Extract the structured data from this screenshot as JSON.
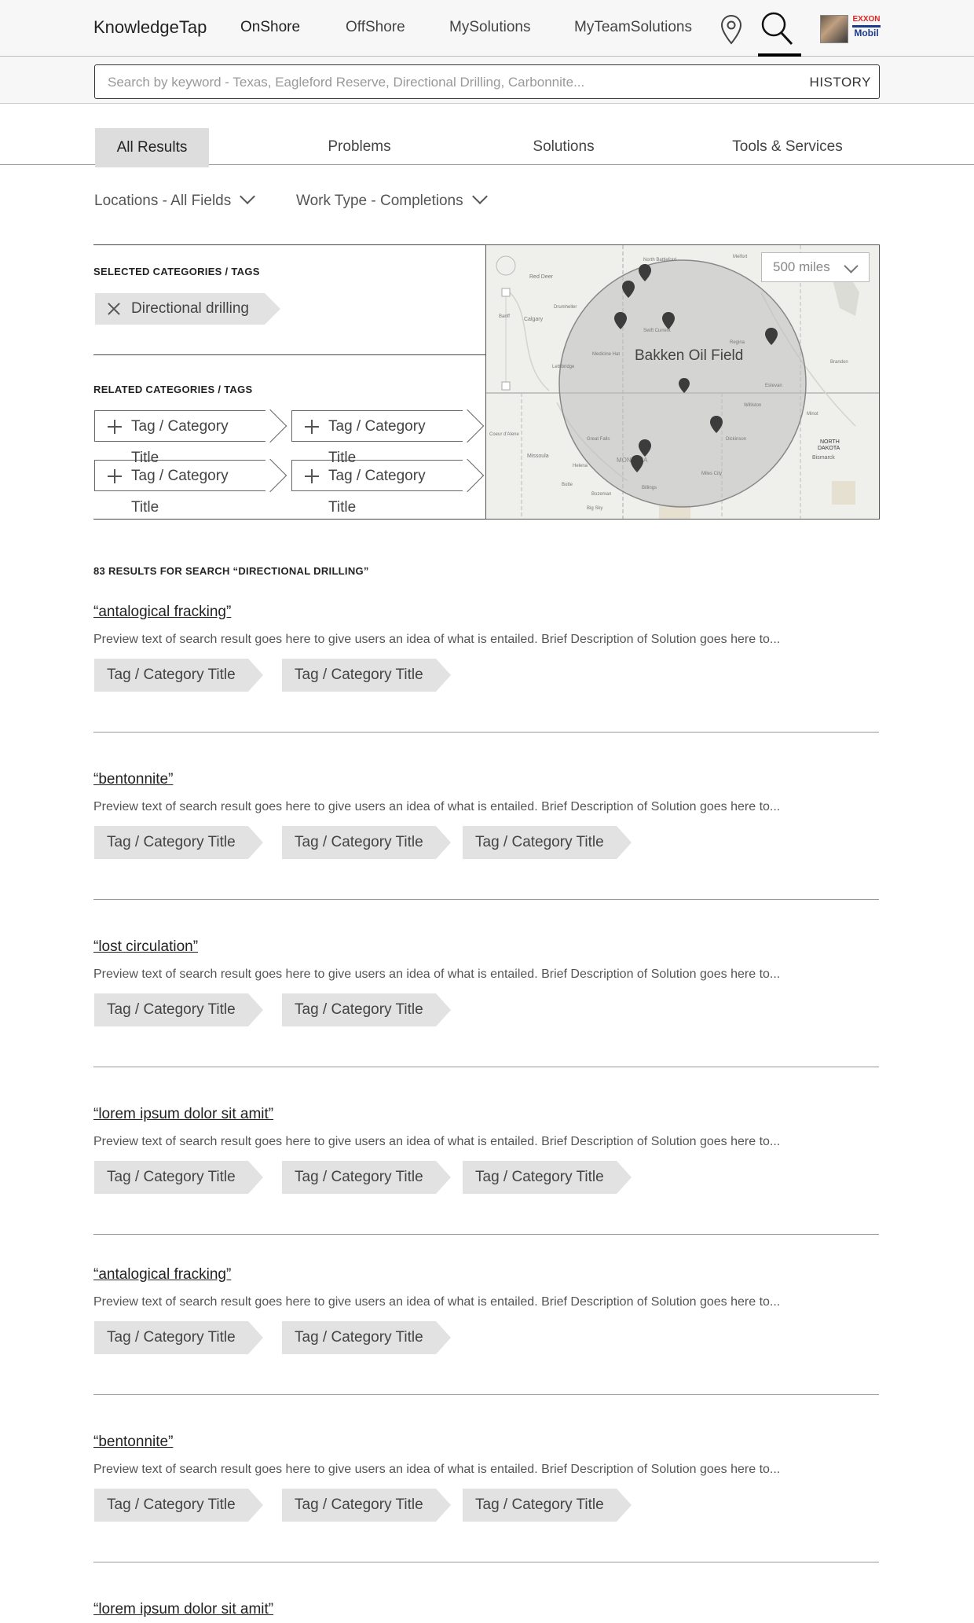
{
  "header": {
    "brand": "KnowledgeTap",
    "nav": [
      "OnShore",
      "OffShore",
      "MySolutions",
      "MyTeamSolutions"
    ],
    "logo_top": "EXXON",
    "logo_bottom": "Mobil"
  },
  "search": {
    "placeholder": "Search by keyword - Texas, Eagleford Reserve, Directional Drilling, Carbonnite...",
    "history_label": "HISTORY"
  },
  "tabs": [
    "All Results",
    "Problems",
    "Solutions",
    "Tools & Services"
  ],
  "filters": {
    "locations": "Locations - All Fields",
    "work_type": "Work Type - Completions"
  },
  "selected": {
    "title": "SELECTED CATEGORIES / TAGS",
    "tag": "Directional drilling"
  },
  "related": {
    "title": "RELATED CATEGORIES / TAGS",
    "tags": [
      "Tag / Category Title",
      "Tag / Category Title",
      "Tag / Category Title",
      "Tag / Category Title"
    ]
  },
  "map": {
    "distance": "500 miles",
    "field_label": "Bakken Oil Field",
    "place_labels": [
      "Red Deer",
      "Calgary",
      "Drumheller",
      "Banff",
      "Lethbridge",
      "Medicine Hat",
      "Regina",
      "Brandon",
      "Minot",
      "Bismarck",
      "NORTH",
      "DAKOTA",
      "Missoula",
      "Helena",
      "Great Falls",
      "Billings",
      "Bozeman",
      "Butte",
      "Big Sky",
      "Miles City",
      "MONTANA",
      "Coeur d'Alene",
      "Dickinson",
      "Williston",
      "Estevan",
      "Swift Current",
      "North Battleford",
      "Melfort"
    ]
  },
  "results": {
    "count_text": "83 RESULTS FOR SEARCH “DIRECTIONAL DRILLING”",
    "items": [
      {
        "title": "“antalogical fracking”",
        "desc": "Preview text of search result goes here to give users an idea of what is entailed. Brief Description of Solution goes here to...",
        "tags": [
          "Tag / Category Title",
          "Tag / Category Title"
        ]
      },
      {
        "title": "“bentonnite”",
        "desc": "Preview text of search result goes here to give users an idea of what is entailed. Brief Description of Solution goes here to...",
        "tags": [
          "Tag / Category Title",
          "Tag / Category Title",
          "Tag / Category Title"
        ]
      },
      {
        "title": "“lost circulation”",
        "desc": "Preview text of search result goes here to give users an idea of what is entailed. Brief Description of Solution goes here to...",
        "tags": [
          "Tag / Category Title",
          "Tag / Category Title"
        ]
      },
      {
        "title": "“lorem ipsum dolor sit amit”",
        "desc": "Preview text of search result goes here to give users an idea of what is entailed. Brief Description of Solution goes here to...",
        "tags": [
          "Tag / Category Title",
          "Tag / Category Title",
          "Tag / Category Title"
        ]
      },
      {
        "title": "“antalogical fracking”",
        "desc": "Preview text of search result goes here to give users an idea of what is entailed. Brief Description of Solution goes here to...",
        "tags": [
          "Tag / Category Title",
          "Tag / Category Title"
        ]
      },
      {
        "title": "“bentonnite”",
        "desc": "Preview text of search result goes here to give users an idea of what is entailed. Brief Description of Solution goes here to...",
        "tags": [
          "Tag / Category Title",
          "Tag / Category Title",
          "Tag / Category Title"
        ]
      },
      {
        "title": "“lorem ipsum dolor sit amit”",
        "desc": "",
        "tags": []
      }
    ]
  }
}
